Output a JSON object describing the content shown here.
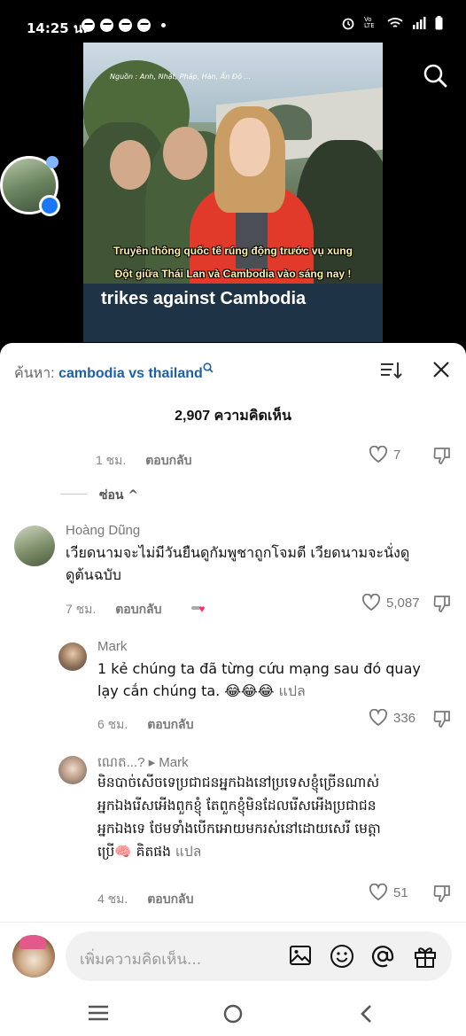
{
  "status_bar": {
    "time": "14:25 น.",
    "icons": [
      "messenger-icon",
      "messenger-icon",
      "messenger-icon",
      "messenger-icon",
      "dot",
      "alarm-icon",
      "volte-icon",
      "wifi-icon",
      "signal-icon",
      "battery-icon"
    ],
    "volte_label": "Vo LTE"
  },
  "video": {
    "source_caption": "Nguồn : Anh, Nhật, Pháp, Hàn, Ấn Độ ...",
    "caption_line1": "Truyền thông quốc tế rúng động trước vụ xung",
    "caption_line2": "Đột giữa Thái Lan và Cambodia vào sáng nay !",
    "banner_text": "trikes against Cambodia"
  },
  "panel": {
    "search_prefix": "ค้นหา:",
    "search_term": "cambodia vs thailand",
    "comment_count": "2,907 ความคิดเห็น",
    "hide_label": "ซ่อน ^",
    "reply_label": "ตอบกลับ"
  },
  "comments": [
    {
      "time": "1 ชม.",
      "likes": "7"
    },
    {
      "name": "Hoàng Dũng",
      "text_line1": "เวียดนามจะไม่มีวันยืนดูกัมพูชาถูกโจมตี เวียดนามจะนั่งดู",
      "text_line2": "ดูต้นฉบับ",
      "time": "7 ชม.",
      "likes": "5,087"
    },
    {
      "name": "Mark",
      "text_line1": "1 kẻ chúng ta đã từng cứu mạng sau đó quay",
      "text_line2": "lạy cắn chúng ta. 😂😂😂",
      "translate": "แปล",
      "time": "6 ชม.",
      "likes": "336"
    },
    {
      "name": "ណេត...?",
      "reply_to": "▸ Mark",
      "text_line1": "មិនបាច់សើចទេប្រជាជនអ្នកឯងនៅប្រទេសខ្ញុំច្រើនណាស់",
      "text_line2": "អ្នកឯងរើសអើងពួកខ្ញុំ តែពួកខ្ញុំមិនដែលរើសអើងប្រជាជន",
      "text_line3": "អ្នកឯងទេ ថែមទាំងបើកអោយមករស់នៅដោយសេរី មេត្តា",
      "text_line4": "ប្រើ🧠 គិតផង",
      "translate": "แปล",
      "time": "4 ชม.",
      "likes": "51"
    }
  ],
  "composer": {
    "placeholder": "เพิ่มความคิดเห็น..."
  },
  "colors": {
    "accent_blue": "#1d5fa8",
    "heart_pink": "#ff2d6b",
    "panel_bg": "#ffffff",
    "page_bg": "#000000"
  }
}
